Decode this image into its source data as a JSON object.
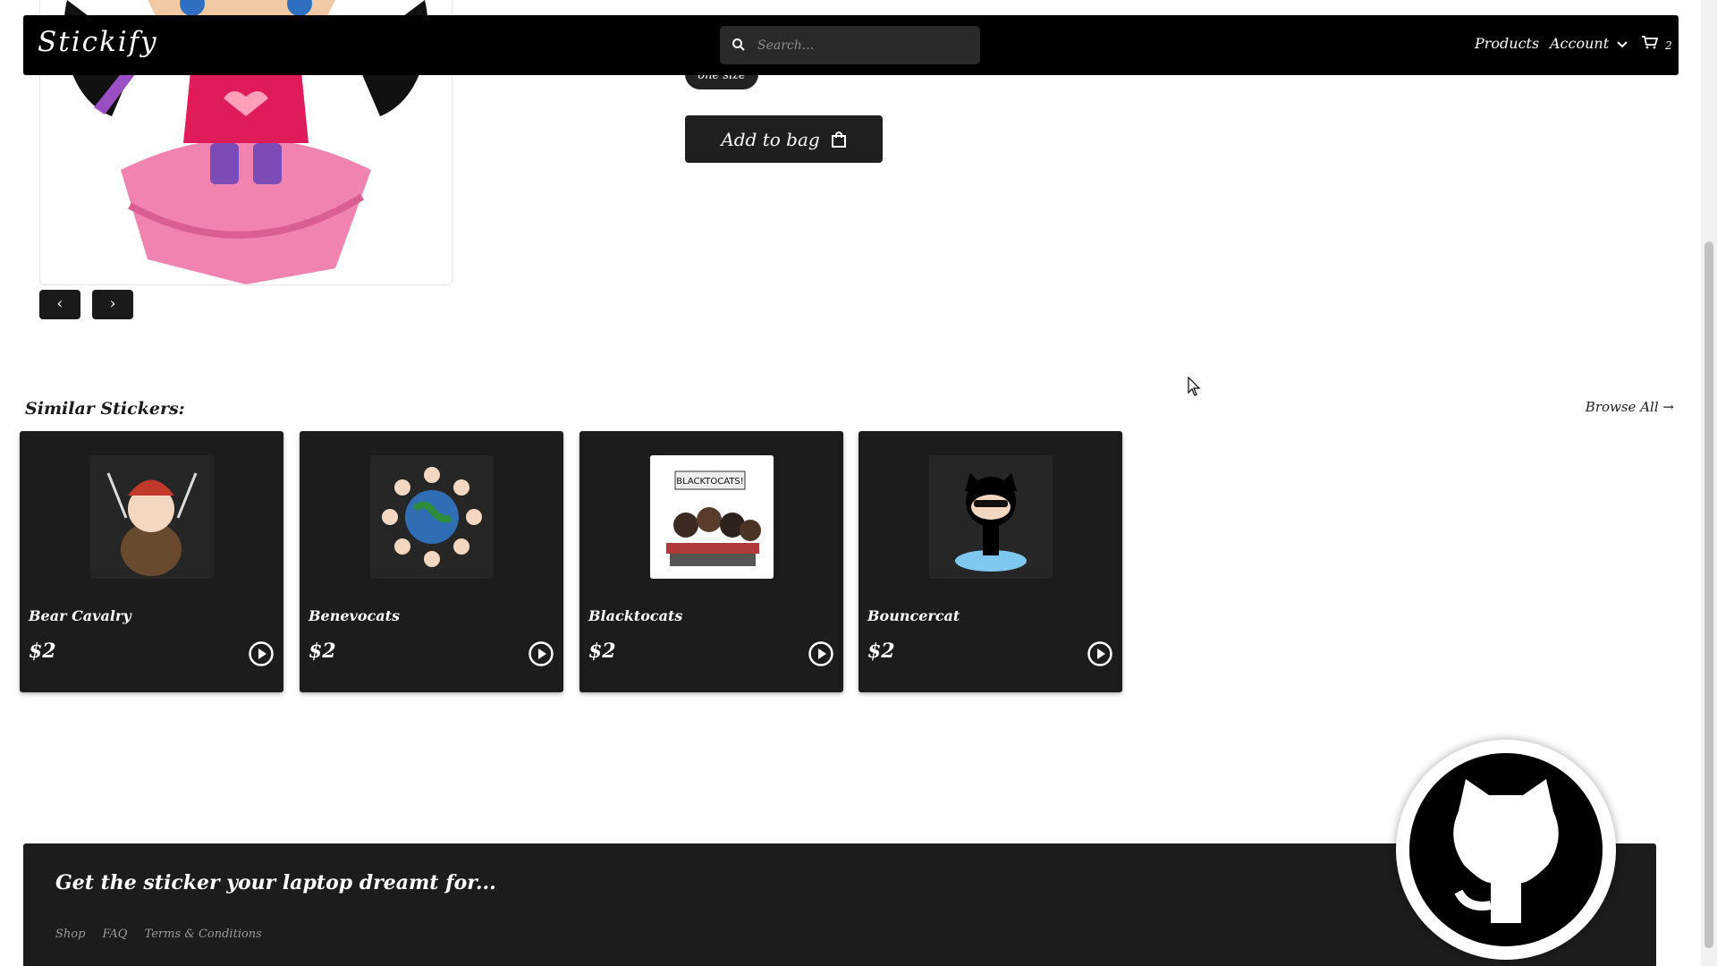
{
  "navbar": {
    "logo": "Stickify",
    "search_placeholder": "Search...",
    "products_label": "Products",
    "account_label": "Account",
    "cart_count": "2"
  },
  "product": {
    "size_label": "one size",
    "add_to_bag_label": "Add to bag",
    "prev_label": "‹",
    "next_label": "›"
  },
  "similar": {
    "title": "Similar Stickers:",
    "browse_all_label": "Browse All",
    "items": [
      {
        "name": "Bear Cavalry",
        "price": "$2"
      },
      {
        "name": "Benevocats",
        "price": "$2"
      },
      {
        "name": "Blacktocats",
        "price": "$2"
      },
      {
        "name": "Bouncercat",
        "price": "$2"
      }
    ]
  },
  "blacktocats_banner": "BLACKTOCATS!",
  "footer": {
    "tagline": "Get the sticker your laptop dreamt for...",
    "links": [
      "Shop",
      "FAQ",
      "Terms & Conditions"
    ]
  }
}
